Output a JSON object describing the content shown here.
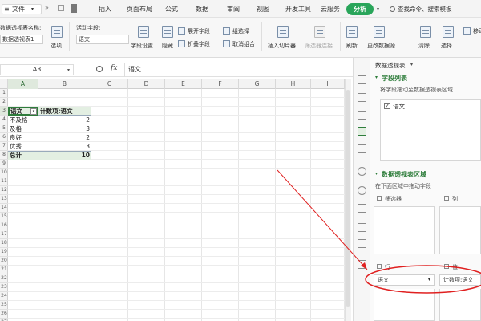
{
  "menubar": {
    "file_label": "文件",
    "tabs": [
      "插入",
      "页面布局",
      "公式",
      "数据",
      "审阅",
      "视图",
      "开发工具",
      "云服务"
    ],
    "active_tab": "分析",
    "search_text": "查找命令、搜索模板"
  },
  "ribbon": {
    "pivot_name_label": "数据透视表名称:",
    "pivot_name_value": "数据透视表1",
    "options_label": "选项",
    "active_field_label": "活动字段:",
    "active_field_value": "语文",
    "field_settings_label": "字段设置",
    "hide_label": "隐藏",
    "expand_field_label": "展开字段",
    "collapse_field_label": "折叠字段",
    "group_select_label": "组选择",
    "ungroup_label": "取消组合",
    "insert_slicer_label": "插入切片器",
    "filter_connection_label": "筛选器连接",
    "refresh_label": "刷新",
    "change_source_label": "更改数据源",
    "clear_label": "清除",
    "select_label": "选择",
    "move_label": "移动"
  },
  "formula_bar": {
    "name_box": "A3",
    "formula_icon": "fx",
    "content": "语文"
  },
  "columns": [
    "A",
    "B",
    "C",
    "D",
    "E",
    "F",
    "G",
    "H",
    "I"
  ],
  "rows": [
    "1",
    "2",
    "3",
    "4",
    "5",
    "6",
    "7",
    "8",
    "9",
    "10",
    "11",
    "12",
    "13",
    "14",
    "15",
    "16",
    "17",
    "18",
    "19",
    "20",
    "21",
    "22",
    "23",
    "24",
    "25",
    "26",
    "27",
    "28"
  ],
  "pivot_table": {
    "header_field": "语文",
    "header_value": "计数项:语文",
    "rows": [
      {
        "label": "不及格",
        "value": "2"
      },
      {
        "label": "及格",
        "value": "3"
      },
      {
        "label": "良好",
        "value": "2"
      },
      {
        "label": "优秀",
        "value": "3"
      }
    ],
    "total_label": "总计",
    "total_value": "10"
  },
  "side_strip": {
    "icons": [
      "cursor-icon",
      "shape-icon",
      "format-icon",
      "pivot-icon",
      "copy-icon",
      "history-icon",
      "help-icon",
      "list-icon",
      "tools-icon",
      "archive-icon",
      "grid-icon"
    ]
  },
  "pivot_pane": {
    "title": "数据透视表",
    "field_list_header": "字段列表",
    "field_list_hint": "将字段拖动至数据透视表区域",
    "fields": [
      {
        "label": "语文",
        "checked": true
      }
    ],
    "areas_header": "数据透视表区域",
    "areas_hint": "在下面区域中拖动字段",
    "filter_label": "筛选器",
    "columns_label": "列",
    "rows_label": "行",
    "values_label": "值",
    "row_field": "语文",
    "value_field": "计数项:语文"
  },
  "colors": {
    "accent": "#29a55a",
    "annotation": "#e02020",
    "header_green": "#2e7d3b"
  }
}
